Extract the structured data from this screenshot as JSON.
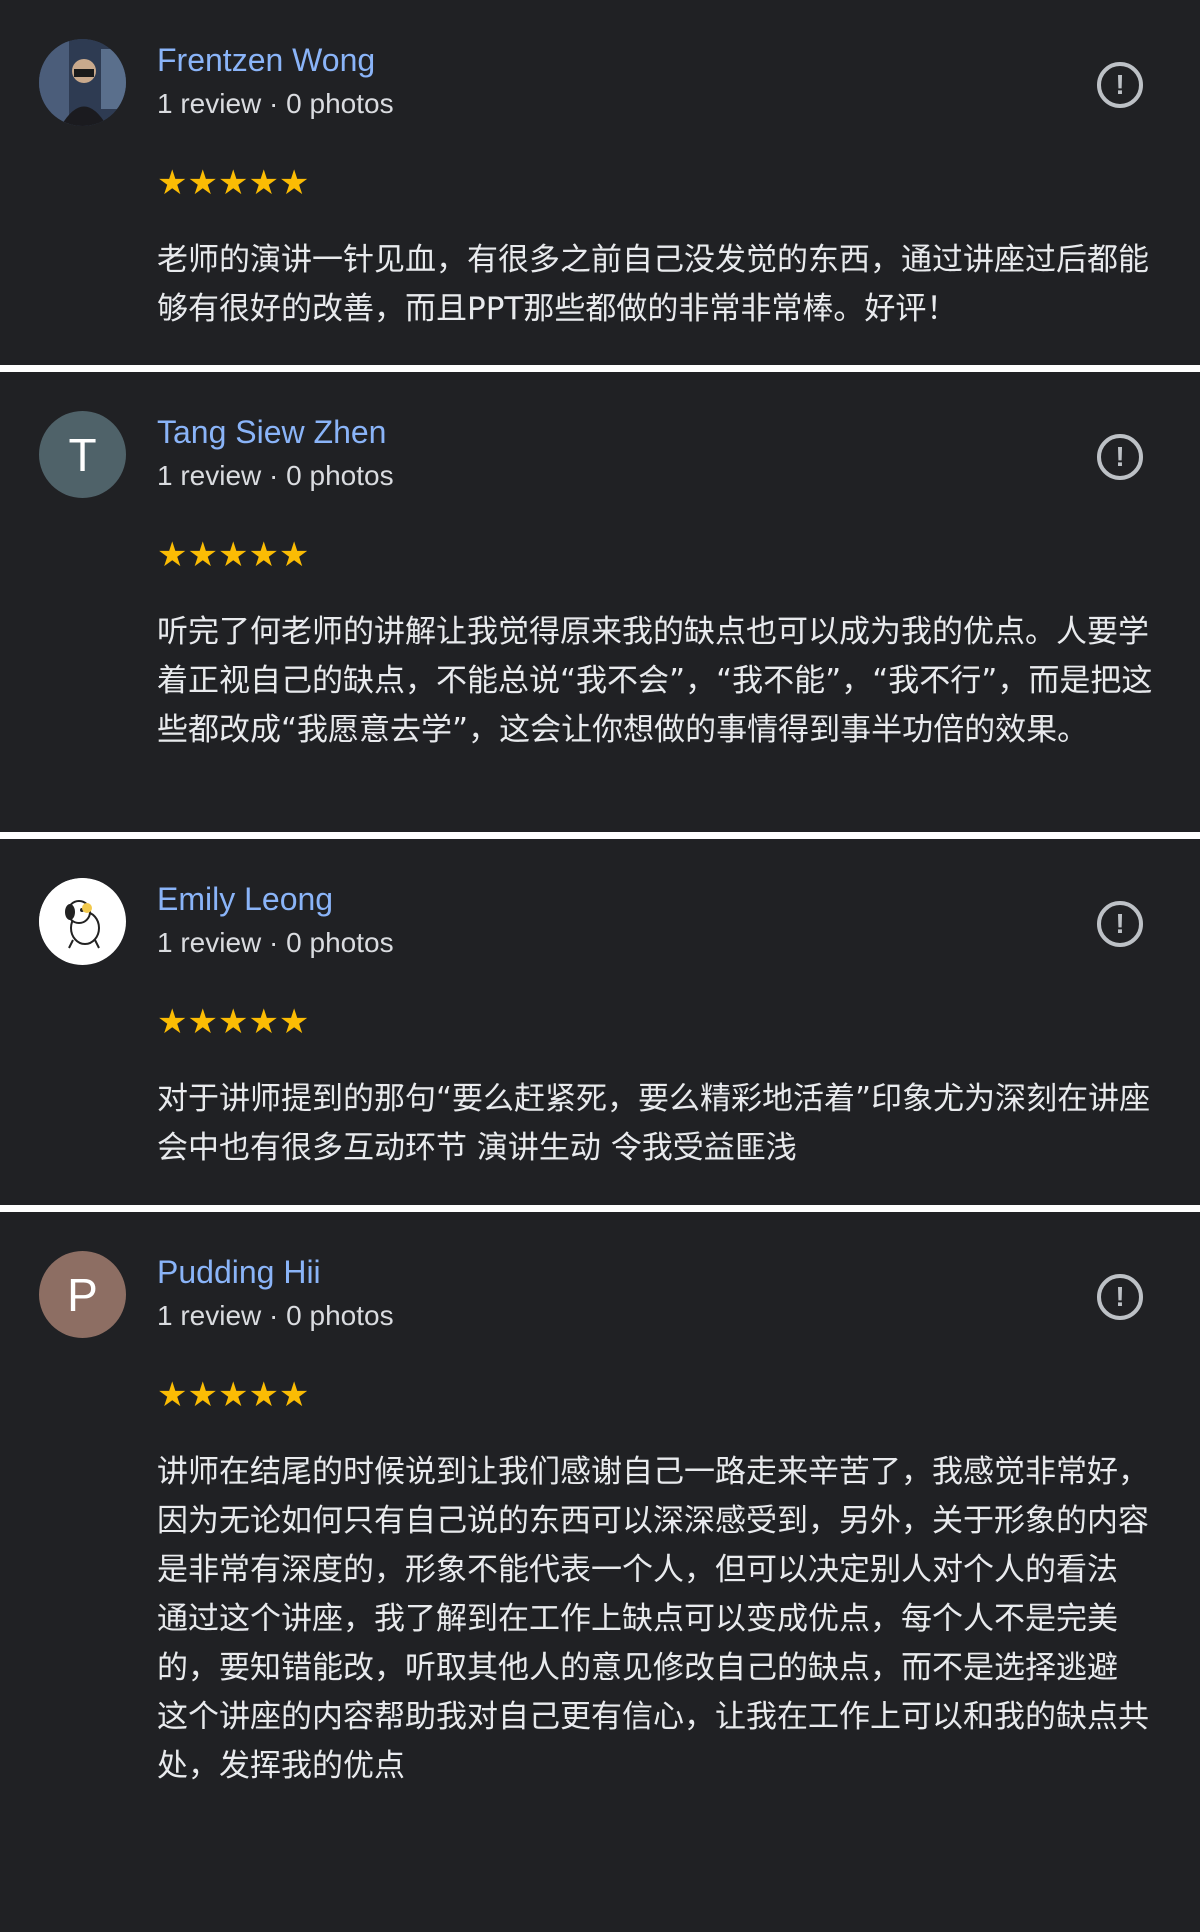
{
  "reviews": [
    {
      "name": "Frentzen Wong",
      "meta": "1 review · 0 photos",
      "avatar_letter": "",
      "avatar_color": "#3a4a63",
      "stars": "★★★★★",
      "rating": 5,
      "text": "老师的演讲一针见血，有很多之前自己没发觉的东西，通过讲座过后都能够有很好的改善，而且PPT那些都做的非常非常棒。好评！"
    },
    {
      "name": "Tang Siew Zhen",
      "meta": "1 review · 0 photos",
      "avatar_letter": "T",
      "avatar_color": "#4f6269",
      "stars": "★★★★★",
      "rating": 5,
      "text": "听完了何老师的讲解让我觉得原来我的缺点也可以成为我的优点。人要学着正视自己的缺点，不能总说“我不会”，“我不能”，“我不行”，而是把这些都改成“我愿意去学”，这会让你想做的事情得到事半功倍的效果。"
    },
    {
      "name": "Emily Leong",
      "meta": "1 review · 0 photos",
      "avatar_letter": "",
      "avatar_color": "#ffffff",
      "stars": "★★★★★",
      "rating": 5,
      "text": "对于讲师提到的那句“要么赶紧死，要么精彩地活着”印象尤为深刻在讲座会中也有很多互动环节 演讲生动 令我受益匪浅"
    },
    {
      "name": "Pudding Hii",
      "meta": "1 review · 0 photos",
      "avatar_letter": "P",
      "avatar_color": "#8d6e63",
      "stars": "★★★★★",
      "rating": 5,
      "text": "讲师在结尾的时候说到让我们感谢自己一路走来辛苦了，我感觉非常好，因为无论如何只有自己说的东西可以深深感受到，另外，关于形象的内容是非常有深度的，形象不能代表一个人，但可以决定别人对个人的看法\n通过这个讲座，我了解到在工作上缺点可以变成优点，每个人不是完美的，要知错能改，听取其他人的意见修改自己的缺点，而不是选择逃避\n这个讲座的内容帮助我对自己更有信心，让我在工作上可以和我的缺点共处，发挥我的优点"
    }
  ],
  "flag_icon": "flag-report-icon",
  "star_color": "#fbbc04",
  "name_color": "#8ab4f8"
}
